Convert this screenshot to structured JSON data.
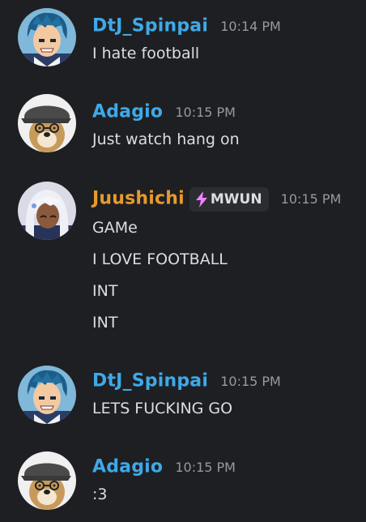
{
  "colors": {
    "background": "#1e1f22",
    "blue_name": "#3fa9e8",
    "orange_name": "#e69a2d",
    "tag_bolt": "#f47fff",
    "message_text": "#dbdee1",
    "timestamp_text": "#949ba4"
  },
  "messages": [
    {
      "username": "DtJ_Spinpai",
      "timestamp": "10:14 PM",
      "avatar": "blue-hair-anime-avatar",
      "lines": [
        "I hate football"
      ]
    },
    {
      "username": "Adagio",
      "timestamp": "10:15 PM",
      "avatar": "dog-with-cap-avatar",
      "lines": [
        "Just watch hang on"
      ]
    },
    {
      "username": "Juushichi",
      "timestamp": "10:15 PM",
      "avatar": "white-hair-anime-avatar",
      "tag": {
        "icon": "lightning-bolt-icon",
        "text": "MWUN"
      },
      "lines": [
        "GAMe",
        "I LOVE FOOTBALL",
        "INT",
        "INT"
      ]
    },
    {
      "username": "DtJ_Spinpai",
      "timestamp": "10:15 PM",
      "avatar": "blue-hair-anime-avatar",
      "lines": [
        "LETS FUCKING GO"
      ]
    },
    {
      "username": "Adagio",
      "timestamp": "10:15 PM",
      "avatar": "dog-with-cap-avatar",
      "lines": [
        ":3"
      ]
    }
  ]
}
